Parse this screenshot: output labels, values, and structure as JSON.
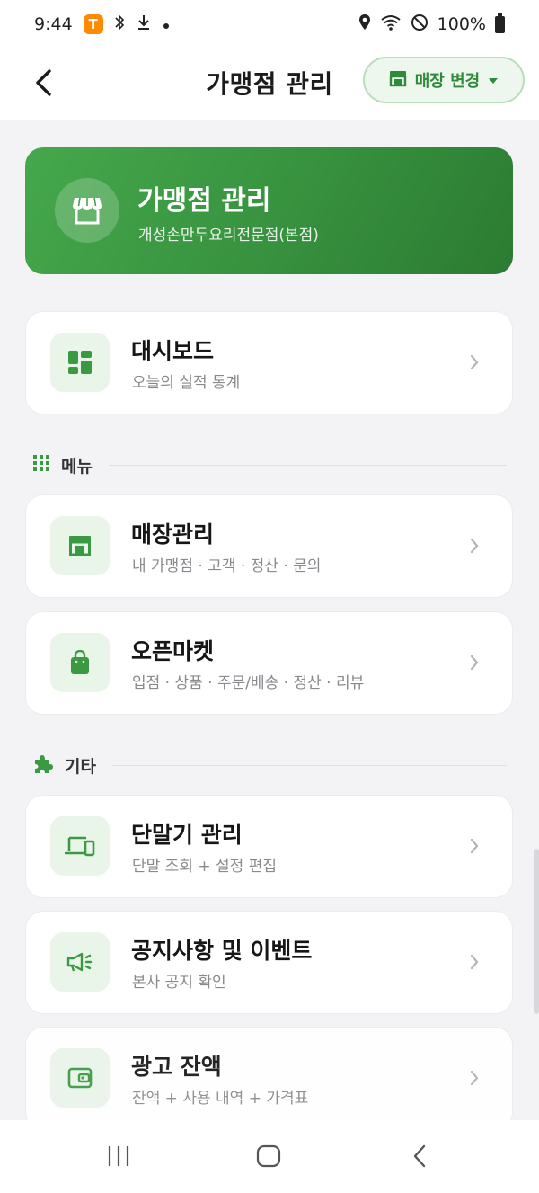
{
  "status": {
    "time": "9:44",
    "app_badge": "T",
    "battery": "100%"
  },
  "header": {
    "title": "가맹점 관리",
    "store_change_label": "매장 변경"
  },
  "hero": {
    "title": "가맹점 관리",
    "subtitle": "개성손만두요리전문점(본점)"
  },
  "dashboard": {
    "title": "대시보드",
    "subtitle": "오늘의 실적 통계"
  },
  "sections": {
    "menu": {
      "label": "메뉴",
      "items": [
        {
          "title": "매장관리",
          "subtitle": "내 가맹점 · 고객 · 정산 · 문의"
        },
        {
          "title": "오픈마켓",
          "subtitle": "입점 · 상품 · 주문/배송 · 정산 · 리뷰"
        }
      ]
    },
    "etc": {
      "label": "기타",
      "items": [
        {
          "title": "단말기 관리",
          "subtitle": "단말 조회 + 설정 편집"
        },
        {
          "title": "공지사항 및 이벤트",
          "subtitle": "본사 공지 확인"
        },
        {
          "title": "광고 잔액",
          "subtitle": "잔액 + 사용 내역 + 가격표"
        }
      ]
    }
  },
  "colors": {
    "accent": "#3a9a41",
    "accent_light": "#eaf5ea"
  }
}
